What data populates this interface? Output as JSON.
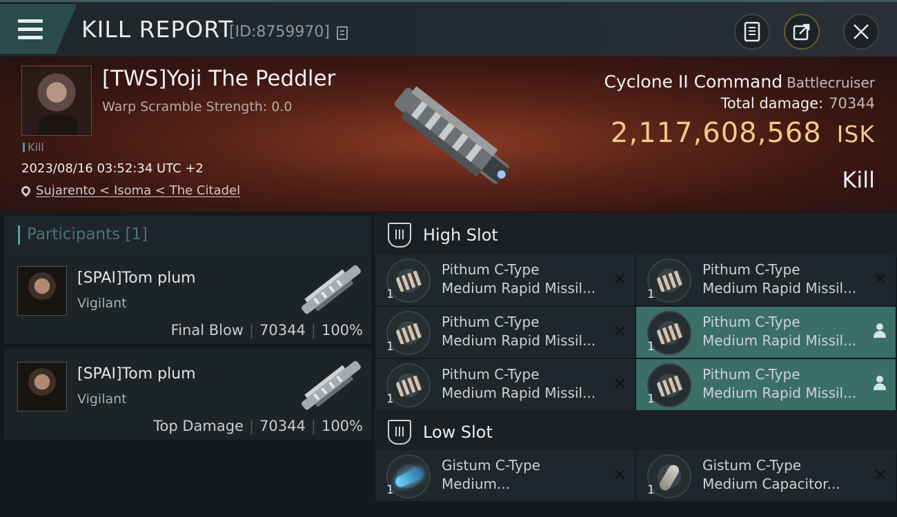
{
  "header": {
    "title": "KILL REPORT",
    "report_id": "[ID:8759970]",
    "icons": [
      "menu-icon",
      "copy-icon",
      "clipboard-icon",
      "share-icon",
      "close-icon"
    ]
  },
  "victim": {
    "name": "[TWS]Yoji The Peddler",
    "warp": "Warp Scramble Strength: 0.0",
    "tag": "Kill",
    "datetime": "2023/08/16 03:52:34 UTC +2",
    "location": "Sujarento < Isoma < The Citadel",
    "ship_name": "Cyclone II Command",
    "ship_class": "Battlecruiser",
    "total_damage_label": "Total damage:",
    "total_damage": "70344",
    "isk_value": "2,117,608,568",
    "isk_unit": "ISK",
    "result": "Kill"
  },
  "participants": {
    "header": "Participants [1]",
    "items": [
      {
        "name": "[SPAI]Tom plum",
        "ship": "Vigilant",
        "label": "Final Blow",
        "damage": "70344",
        "percent": "100%"
      },
      {
        "name": "[SPAI]Tom plum",
        "ship": "Vigilant",
        "label": "Top Damage",
        "damage": "70344",
        "percent": "100%"
      }
    ]
  },
  "slots": {
    "high": {
      "label": "High Slot",
      "items": [
        {
          "qty": "1",
          "line1": "Pithum C-Type",
          "line2": "Medium Rapid Missil...",
          "state": "destroyed"
        },
        {
          "qty": "1",
          "line1": "Pithum C-Type",
          "line2": "Medium Rapid Missil...",
          "state": "destroyed"
        },
        {
          "qty": "1",
          "line1": "Pithum C-Type",
          "line2": "Medium Rapid Missil...",
          "state": "destroyed"
        },
        {
          "qty": "1",
          "line1": "Pithum C-Type",
          "line2": "Medium Rapid Missil...",
          "state": "dropped"
        },
        {
          "qty": "1",
          "line1": "Pithum C-Type",
          "line2": "Medium Rapid Missil...",
          "state": "destroyed"
        },
        {
          "qty": "1",
          "line1": "Pithum C-Type",
          "line2": "Medium Rapid Missil...",
          "state": "dropped"
        }
      ]
    },
    "low": {
      "label": "Low Slot",
      "items": [
        {
          "qty": "1",
          "line1": "Gistum C-Type",
          "line2": "Medium...",
          "state": "destroyed"
        },
        {
          "qty": "1",
          "line1": "Gistum C-Type",
          "line2": "Medium Capacitor...",
          "state": "destroyed"
        }
      ]
    }
  },
  "colors": {
    "accent": "#4fa3ab",
    "isk": "#f3c98a",
    "active_item": "#3b6e68"
  }
}
